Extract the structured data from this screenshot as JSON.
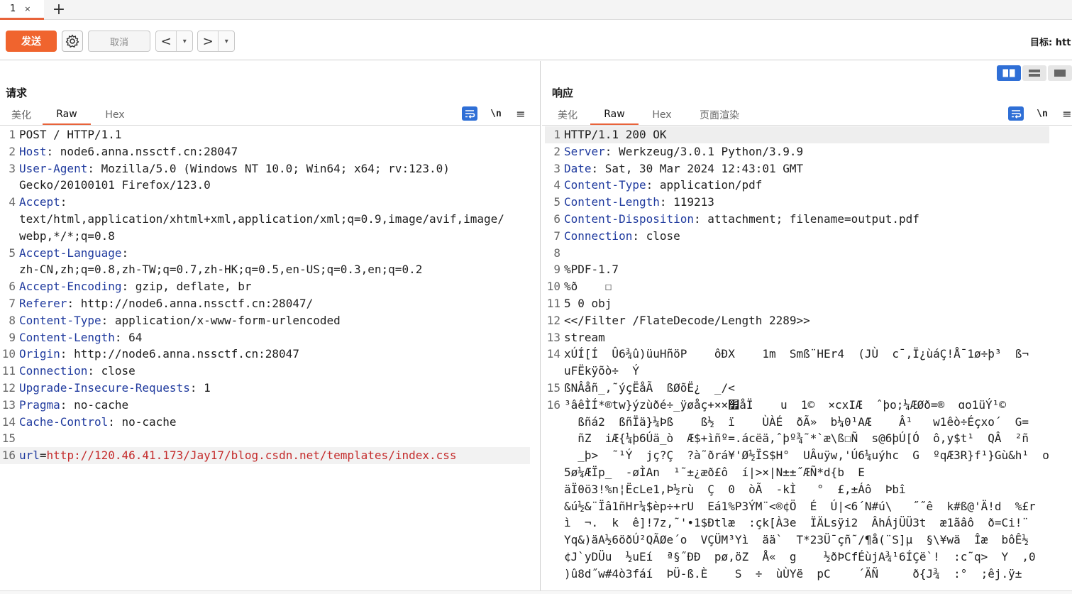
{
  "tabs": [
    {
      "label": "1",
      "close": "×"
    }
  ],
  "tab_add": "+",
  "toolbar": {
    "send_label": "发送",
    "cancel_label": "取消",
    "back_glyph": "<",
    "forward_glyph": ">",
    "dropdown_glyph": "▾",
    "target_label": "目标: htt"
  },
  "request": {
    "title": "请求",
    "subtabs": [
      "美化",
      "Raw",
      "Hex"
    ],
    "active_subtab": "Raw",
    "newline_toggle": "\\n",
    "menu_glyph": "≡",
    "lines": [
      {
        "n": "1",
        "text": "POST / HTTP/1.1"
      },
      {
        "n": "2",
        "key": "Host",
        "val": " node6.anna.nssctf.cn:28047"
      },
      {
        "n": "3",
        "key": "User-Agent",
        "val": " Mozilla/5.0 (Windows NT 10.0; Win64; x64; rv:123.0)"
      },
      {
        "n": "",
        "text": "Gecko/20100101 Firefox/123.0"
      },
      {
        "n": "4",
        "key": "Accept",
        "val": ""
      },
      {
        "n": "",
        "text": "text/html,application/xhtml+xml,application/xml;q=0.9,image/avif,image/"
      },
      {
        "n": "",
        "text": "webp,*/*;q=0.8"
      },
      {
        "n": "5",
        "key": "Accept-Language",
        "val": ""
      },
      {
        "n": "",
        "text": "zh-CN,zh;q=0.8,zh-TW;q=0.7,zh-HK;q=0.5,en-US;q=0.3,en;q=0.2"
      },
      {
        "n": "6",
        "key": "Accept-Encoding",
        "val": " gzip, deflate, br"
      },
      {
        "n": "7",
        "key": "Referer",
        "val": " http://node6.anna.nssctf.cn:28047/"
      },
      {
        "n": "8",
        "key": "Content-Type",
        "val": " application/x-www-form-urlencoded"
      },
      {
        "n": "9",
        "key": "Content-Length",
        "val": " 64"
      },
      {
        "n": "10",
        "key": "Origin",
        "val": " http://node6.anna.nssctf.cn:28047"
      },
      {
        "n": "11",
        "key": "Connection",
        "val": " close"
      },
      {
        "n": "12",
        "key": "Upgrade-Insecure-Requests",
        "val": " 1"
      },
      {
        "n": "13",
        "key": "Pragma",
        "val": " no-cache"
      },
      {
        "n": "14",
        "key": "Cache-Control",
        "val": " no-cache"
      },
      {
        "n": "15",
        "text": ""
      }
    ],
    "body_line": {
      "n": "16",
      "param": "url",
      "eq": "=",
      "value": "http://120.46.41.173/Jay17/blog.csdn.net/templates/index.css"
    }
  },
  "response": {
    "title": "响应",
    "subtabs": [
      "美化",
      "Raw",
      "Hex",
      "页面渲染"
    ],
    "active_subtab": "Raw",
    "newline_toggle": "\\n",
    "menu_glyph": "≡",
    "lines": [
      {
        "n": "1",
        "text": "HTTP/1.1 200 OK"
      },
      {
        "n": "2",
        "key": "Server",
        "val": " Werkzeug/3.0.1 Python/3.9.9"
      },
      {
        "n": "3",
        "key": "Date",
        "val": " Sat, 30 Mar 2024 12:43:01 GMT"
      },
      {
        "n": "4",
        "key": "Content-Type",
        "val": " application/pdf"
      },
      {
        "n": "5",
        "key": "Content-Length",
        "val": " 119213"
      },
      {
        "n": "6",
        "key": "Content-Disposition",
        "val": " attachment; filename=output.pdf"
      },
      {
        "n": "7",
        "key": "Connection",
        "val": " close"
      },
      {
        "n": "8",
        "text": ""
      },
      {
        "n": "9",
        "text": "%PDF-1.7"
      },
      {
        "n": "10",
        "text": "%ð    ☐"
      },
      {
        "n": "11",
        "text": "5 0 obj"
      },
      {
        "n": "12",
        "text": "<</Filter /FlateDecode/Length 2289>>"
      },
      {
        "n": "13",
        "text": "stream"
      },
      {
        "n": "14",
        "text": "xÚÍ[Í  Û6¾û)üuHñöP    ôÐX    1m  Smß¨HEr4  (JÙ  c¯,Ï¿ùáÇ!Å¯1ø÷þ³  ß¬"
      },
      {
        "n": "",
        "text": "uFËkÿõò÷  Ý"
      },
      {
        "n": "15",
        "text": "ßNÂåñ_,˜ýçËåÃ  ßØõË¿  _/<"
      },
      {
        "n": "16",
        "text": "³âêÌÍ*®tw}ýzùðé÷_ÿøåç+××׿åÏ    u  1©  ×cxIÆ  ˆþo;¼ÆØð=®  ɑo1üÝ¹©"
      },
      {
        "n": "",
        "text": "  ßñá2  ßñÏä}¼Þß    ß½  ï    ÙÀÉ  ðÃ»  b¼0¹AÆ    Â¹   w1êò÷Éçxo´  G="
      },
      {
        "n": "",
        "text": "  ñZ  iÆ{¼þ6Úä_ò  Æ$+ìñº=.ácëä,ˆþº¾˜*`æ\\ß☐Ñ  s@6þÚ[Ó  ô,y$t¹  QÂ  ²ñ"
      },
      {
        "n": "",
        "text": "  _þ>  ˜¹Ý  jç?Ç  ?à˜ðrá¥'Ø½ÏS$H°  UÂuÿw,'Ú6¼uýhc  G  ºqÆ3R}f¹}Gù&h¹  o"
      },
      {
        "n": "",
        "text": "5ø¼ÆÏp_  -øÌAn  ¹˜±¿æð£ô  í|>×|N±±˝ÆÑ*d{b  E"
      },
      {
        "n": "",
        "text": "äÏ0ö3!%n¦ËcLe1,Þ½rù  Ç  0  òÃ  -kÌ   °  £,±Áô  Þbî"
      },
      {
        "n": "",
        "text": "&ú½&¨Ïâ1ñHr¼$èp÷+rU  Eá1%P3ÝM¨<®¢Ö  É  Ú|<6´N#ú\\   ˝˝ê  k#ß@'Ä!d  %£r"
      },
      {
        "n": "",
        "text": "ì  ¬.  k  ê]!7z,˜'•1$Ðtlæ  :çk[À3e  ÏÄLsÿi2  ÂhÁjÜÜ3t  æ1ãâô  ð=Ci!¨"
      },
      {
        "n": "",
        "text": "Yq&)äA½6öðÚ²QÃØe´o  VÇÜM³Yì  ää`  T*23Ü¯çñ˜/¶å(¨S]µ  §\\¥wä  Îæ  bôÊ½"
      },
      {
        "n": "",
        "text": "¢J`yDÜu  ½uEí  ª§˝ÐÐ  pø,öZ  Å«  g    ½ðÞCfÉùjA¾¹6ÍÇë`!  :c˜q>  Y  ,0"
      },
      {
        "n": "",
        "text": ")û8d˝w#4ò3fáí  ÞÜ-ß.È    S  ÷  ùÙYë  pC    ´ÄÑ     ð{J¾  :°  ;êj.ÿ±"
      }
    ]
  },
  "colors": {
    "accent": "#f0642e",
    "tab_underline": "#e8633a",
    "header_key": "#1f3a9e",
    "param_value": "#c42b2b",
    "toggle_active": "#2f6fd6"
  }
}
